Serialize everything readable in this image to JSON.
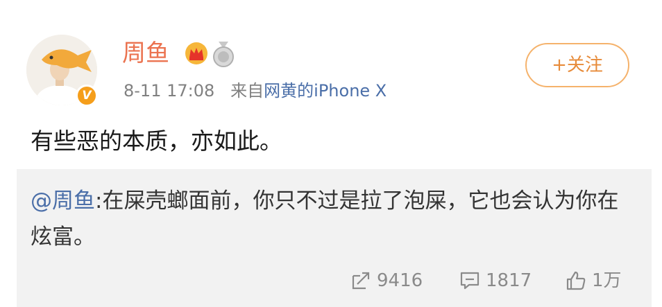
{
  "post": {
    "author": "周鱼",
    "time": "8-11 17:08",
    "source_prefix": "来自",
    "source": "网黄的iPhone X",
    "follow_label": "+关注",
    "text": "有些恶的本质，亦如此。"
  },
  "repost": {
    "mention": "@周鱼",
    "text": ":在屎壳螂面前，你只不过是拉了泡屎，它也会认为你在炫富。"
  },
  "stats": {
    "reposts": "9416",
    "comments": "1817",
    "likes": "1万"
  },
  "colors": {
    "author": "#eb7350",
    "link": "#4a6ea8",
    "follow_border": "#f5b26b",
    "verified_badge": "#f59e1b",
    "card_bg": "#f2f2f2"
  },
  "icons": {
    "verified": "v-badge-icon",
    "crown": "crown-icon",
    "medal": "medal-icon",
    "repost": "repost-icon",
    "comment": "comment-icon",
    "like": "thumbs-up-icon"
  }
}
